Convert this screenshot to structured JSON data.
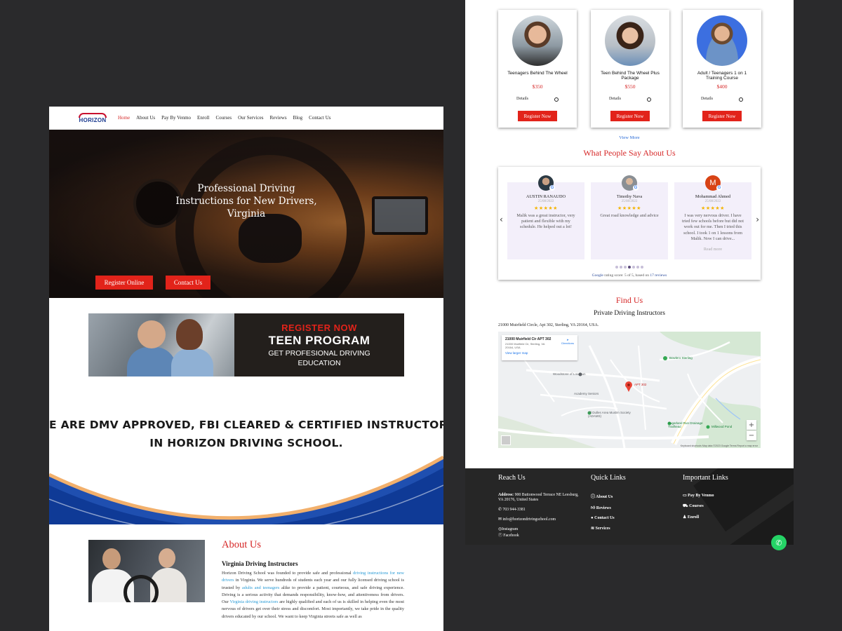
{
  "nav": {
    "logo": "HORIZON",
    "items": [
      "Home",
      "About Us",
      "Pay By Venmo",
      "Enroll",
      "Courses",
      "Our Services",
      "Reviews",
      "Blog",
      "Contact Us"
    ]
  },
  "hero": {
    "title_line1": "Professional Driving",
    "title_line2": "Instructions for New Drivers,",
    "title_line3": "Virginia",
    "btn_register": "Register Online",
    "btn_contact": "Contact Us"
  },
  "banner": {
    "line1": "REGISTER NOW",
    "line2": "TEEN PROGRAM",
    "line3": "GET PROFESIONAL DRIVING",
    "line4": "EDUCATION"
  },
  "dmv": {
    "line1": "WE ARE DMV APPROVED, FBI CLEARED & CERTIFIED INSTRUCTORS",
    "line2": "IN HORIZON DRIVING SCHOOL."
  },
  "about": {
    "title": "About Us",
    "subtitle": "Virginia Driving Instructors",
    "p1": "Horizon Driving School was founded to provide safe and professional ",
    "link1": "driving instructions for new drivers",
    "p2": " in Virginia. We serve hundreds of students each year and our fully licensed driving school is trusted by ",
    "link2": "adults and teenagers",
    "p3": " alike to provide a patient, courteous, and safe driving experience. Driving is a serious activity that demands responsibility, know-how, and attentiveness from drivers. Our ",
    "link3": "Virginia driving instructors",
    "p4": " are highly qualified and each of us is skilled in helping even the most nervous of drivers get over their stress and discomfort. Most importantly, we take pride in the quality drivers educated by our school. We want to keep Virginia streets safe as well as"
  },
  "courses": [
    {
      "title": "Teenagers Behind The Wheel",
      "price": "$350",
      "details": "Details",
      "button": "Register Now"
    },
    {
      "title": "Teen Behind The Wheel Plus Package",
      "price": "$550",
      "details": "Details",
      "button": "Register Now"
    },
    {
      "title": "Adult / Teenagers 1 on 1 Training Course",
      "price": "$400",
      "details": "Details",
      "button": "Register Now"
    }
  ],
  "view_more": "View More",
  "reviews_section": {
    "title": "What People Say About Us",
    "reviews": [
      {
        "name": "AUSTIN RANAUDO",
        "date": "25/08/2022",
        "stars": "★★★★★",
        "text": "Malik was a great instructor, very patient and flexible with my schedule. He helped out a lot!",
        "more": ""
      },
      {
        "name": "Timothy Nava",
        "date": "25/08/2022",
        "stars": "★★★★★",
        "text": "Great road knowledge and advice",
        "more": ""
      },
      {
        "name": "Mohammad Ahmed",
        "date": "25/08/2022",
        "stars": "★★★★★",
        "text": "I was very nervous driver. I have tried few schools before but did not work out for me. Then I tried this school. I took 1 on 1 lessons from Malik. Now I can drive...",
        "more": "Read more"
      }
    ],
    "rating_prefix": "Google",
    "rating_text": " rating score: 5 of 5, based on ",
    "rating_link": "17 reviews"
  },
  "find": {
    "title": "Find Us",
    "subtitle": "Private Driving Instructors",
    "address": "21000 Muirfield Circle, Apt 302, Sterling, VA 20164, USA.",
    "map_card_title": "21000 Muirfield Cir APT 302",
    "map_card_addr": "21000 Muirfield Cir, Sterling, VA 20164, USA",
    "map_card_link": "View larger map",
    "map_directions": "Directions",
    "pin_label": "APT 302",
    "poi1": "Bowlero Sterling",
    "poi2": "Woodstone of Loudoun",
    "poi3": "Academy Seniors",
    "poi4": "All Dulles Area Muslim Society (ADAMS)",
    "poi5": "Sugarland Run Drainage Trailhead",
    "poi6": "Millwood Pond",
    "zoom_in": "+",
    "zoom_out": "−",
    "map_footer": "Keyboard shortcuts   Map data ©2023 Google   Terms   Report a map error"
  },
  "footer": {
    "reach_title": "Reach Us",
    "address_label": "Address:",
    "address": " 900 Buttonwood Terrace NE Leesburg, VA 20176, United States",
    "phone": "703 944-3381",
    "email": "info@horizondrivingschool.com",
    "instagram": "Instagram",
    "facebook": "Facebook",
    "quick_title": "Quick Links",
    "quick_links": [
      "About Us",
      "Reviews",
      "Contact Us",
      "Services"
    ],
    "important_title": "Important Links",
    "important_links": [
      "Pay By Venmo",
      "Courses",
      "Enroll"
    ]
  },
  "colors": {
    "accent_red": "#e2231a",
    "brand_blue": "#1a3a8f",
    "link_blue": "#2a9bd6",
    "footer_bg": "#262626",
    "whatsapp": "#25d366"
  }
}
